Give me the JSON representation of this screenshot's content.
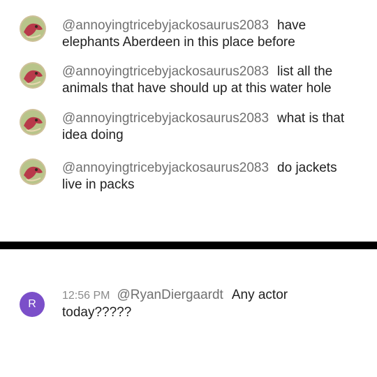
{
  "comments": [
    {
      "handle": "@annoyingtricebyjackosaurus2083",
      "text": "have elephants Aberdeen in this place before",
      "avatar_icon": "dinosaur-avatar-icon"
    },
    {
      "handle": "@annoyingtricebyjackosaurus2083",
      "text": "list all the animals that have should up at this water hole",
      "avatar_icon": "dinosaur-avatar-icon"
    },
    {
      "handle": "@annoyingtricebyjackosaurus2083",
      "text": "what is that idea doing",
      "avatar_icon": "dinosaur-avatar-icon"
    },
    {
      "handle": "@annoyingtricebyjackosaurus2083",
      "text": "do jackets live in packs",
      "avatar_icon": "dinosaur-avatar-icon"
    }
  ],
  "live_comment": {
    "avatar_letter": "R",
    "avatar_color": "#7b4fc9",
    "time": "12:56 PM",
    "handle": "@RyanDiergaardt",
    "text": "Any actor today?????"
  },
  "colors": {
    "divider": "#000000",
    "handle": "#707070"
  }
}
